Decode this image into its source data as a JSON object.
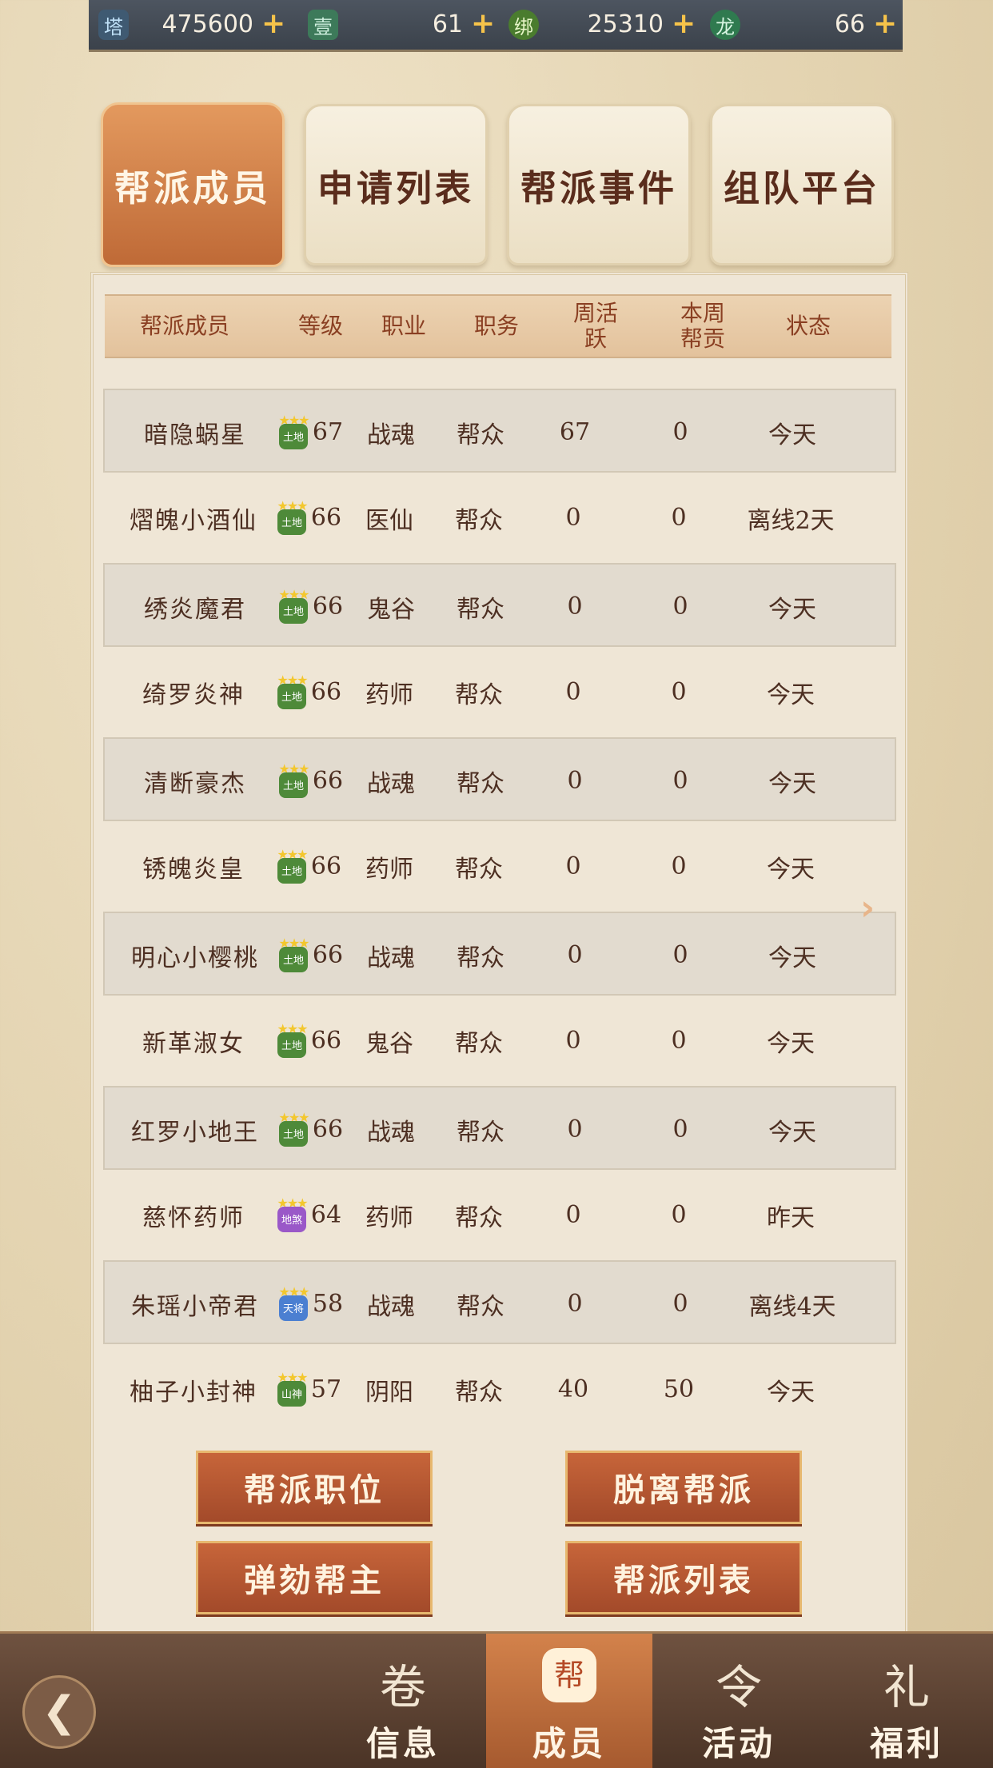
{
  "currency": [
    {
      "icon": "tower-icon",
      "glyph": "塔",
      "value": "475600"
    },
    {
      "icon": "jade-ticket-icon",
      "glyph": "壹",
      "value": "61"
    },
    {
      "icon": "bound-coin-icon",
      "glyph": "绑",
      "value": "25310"
    },
    {
      "icon": "dragon-coin-icon",
      "glyph": "龙",
      "value": "66"
    }
  ],
  "plus_label": "+",
  "tabs": [
    "帮派成员",
    "申请列表",
    "帮派事件",
    "组队平台"
  ],
  "header": {
    "name": "帮派成员",
    "level": "等级",
    "job": "职业",
    "position": "职务",
    "activity": "周活跃",
    "contribution": "本周帮贡",
    "status": "状态"
  },
  "members": [
    {
      "name": "暗隐蜗星",
      "badge": "土地",
      "level": "67",
      "job": "战魂",
      "position": "帮众",
      "activity": "67",
      "contribution": "0",
      "status": "今天"
    },
    {
      "name": "熠魄小酒仙",
      "badge": "土地",
      "level": "66",
      "job": "医仙",
      "position": "帮众",
      "activity": "0",
      "contribution": "0",
      "status": "离线2天"
    },
    {
      "name": "绣炎魔君",
      "badge": "土地",
      "level": "66",
      "job": "鬼谷",
      "position": "帮众",
      "activity": "0",
      "contribution": "0",
      "status": "今天"
    },
    {
      "name": "绮罗炎神",
      "badge": "土地",
      "level": "66",
      "job": "药师",
      "position": "帮众",
      "activity": "0",
      "contribution": "0",
      "status": "今天"
    },
    {
      "name": "清断豪杰",
      "badge": "土地",
      "level": "66",
      "job": "战魂",
      "position": "帮众",
      "activity": "0",
      "contribution": "0",
      "status": "今天"
    },
    {
      "name": "锈魄炎皇",
      "badge": "土地",
      "level": "66",
      "job": "药师",
      "position": "帮众",
      "activity": "0",
      "contribution": "0",
      "status": "今天"
    },
    {
      "name": "明心小樱桃",
      "badge": "土地",
      "level": "66",
      "job": "战魂",
      "position": "帮众",
      "activity": "0",
      "contribution": "0",
      "status": "今天"
    },
    {
      "name": "新革淑女",
      "badge": "土地",
      "level": "66",
      "job": "鬼谷",
      "position": "帮众",
      "activity": "0",
      "contribution": "0",
      "status": "今天"
    },
    {
      "name": "红罗小地王",
      "badge": "土地",
      "level": "66",
      "job": "战魂",
      "position": "帮众",
      "activity": "0",
      "contribution": "0",
      "status": "今天"
    },
    {
      "name": "慈怀药师",
      "badge": "地煞",
      "level": "64",
      "job": "药师",
      "position": "帮众",
      "activity": "0",
      "contribution": "0",
      "status": "昨天"
    },
    {
      "name": "朱瑶小帝君",
      "badge": "天将",
      "level": "58",
      "job": "战魂",
      "position": "帮众",
      "activity": "0",
      "contribution": "0",
      "status": "离线4天"
    },
    {
      "name": "柚子小封神",
      "badge": "山神",
      "level": "57",
      "job": "阴阳",
      "position": "帮众",
      "activity": "40",
      "contribution": "50",
      "status": "今天"
    }
  ],
  "buttons": {
    "positions": "帮派职位",
    "leave": "脱离帮派",
    "impeach": "弹劾帮主",
    "list": "帮派列表"
  },
  "nav": [
    {
      "label": "信息",
      "icon": "scroll-icon",
      "glyph": "卷"
    },
    {
      "label": "成员",
      "icon": "gang-emblem-icon",
      "glyph": "帮"
    },
    {
      "label": "活动",
      "icon": "activity-scroll-icon",
      "glyph": "令"
    },
    {
      "label": "福利",
      "icon": "gift-icon",
      "glyph": "礼"
    }
  ],
  "back_glyph": "❮"
}
